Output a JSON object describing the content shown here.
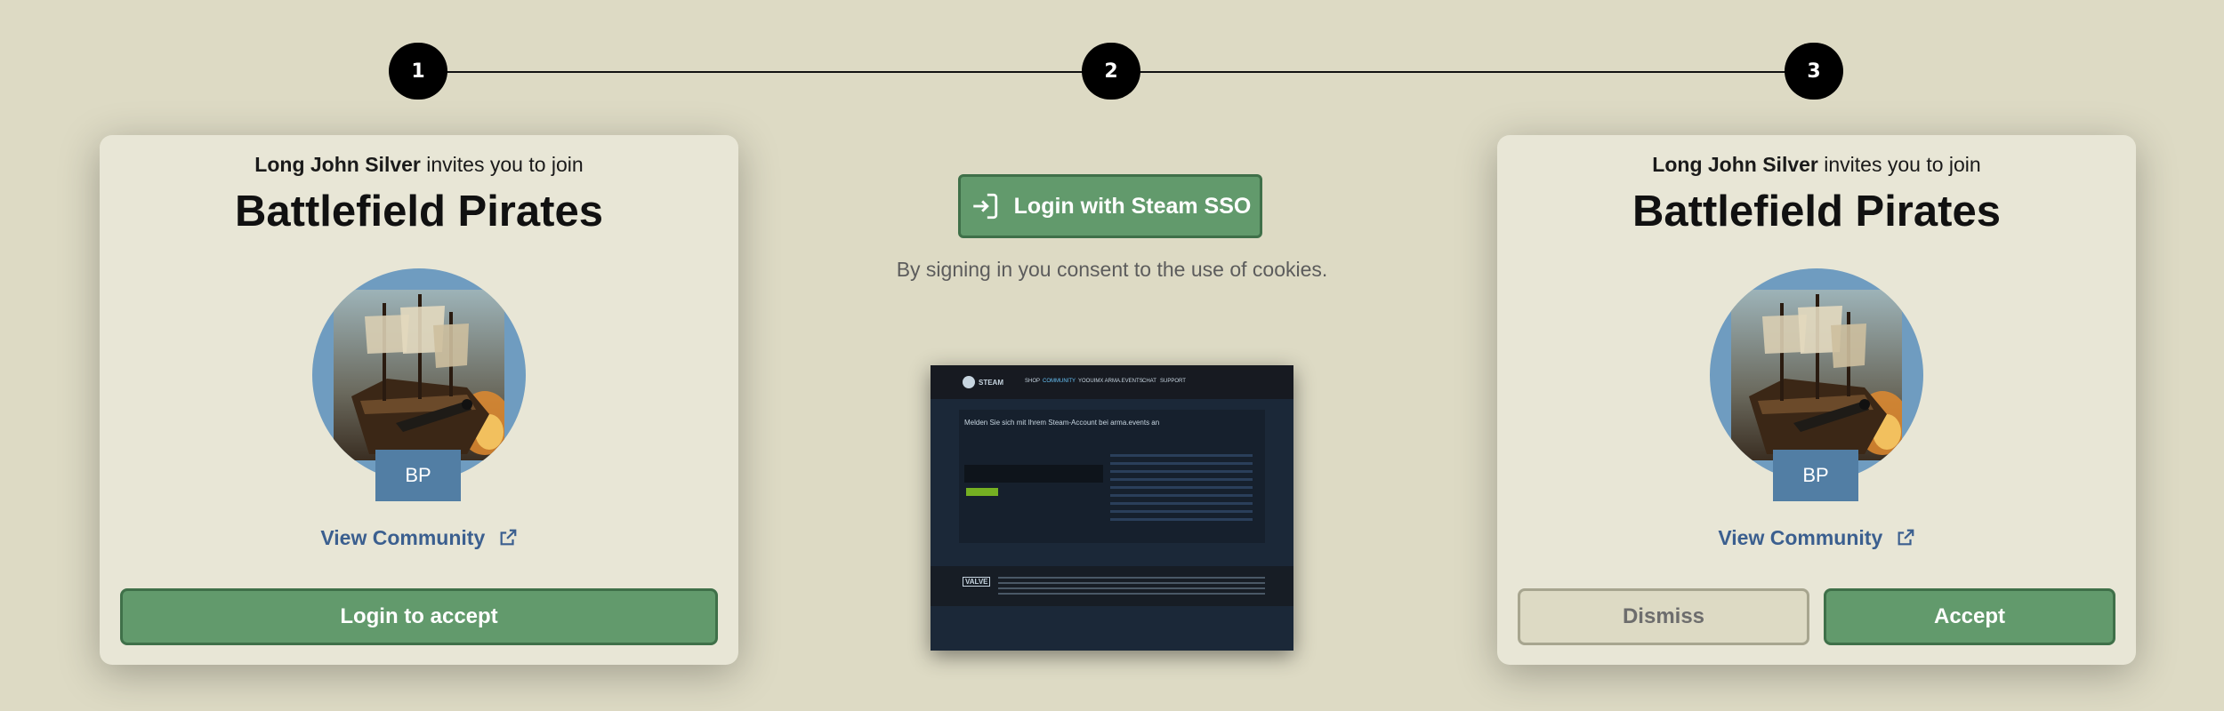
{
  "stepper": {
    "steps": [
      "1",
      "2",
      "3"
    ]
  },
  "card_left": {
    "inviter": "Long John Silver",
    "invite_suffix": "invites you to join",
    "community_name": "Battlefield Pirates",
    "abbreviation": "BP",
    "view_community": "View Community",
    "login_button": "Login to accept"
  },
  "middle": {
    "sso_button": "Login with Steam SSO",
    "consent_text": "By signing in you consent to the use of cookies.",
    "preview": {
      "brand": "STEAM",
      "nav": [
        "SHOP",
        "COMMUNITY",
        "YOOUIMX ARMA.EVENTS",
        "CHAT",
        "SUPPORT"
      ],
      "heading": "Melden Sie sich mit Ihrem Steam-Account bei arma.events an",
      "footer_brand": "VALVE"
    }
  },
  "card_right": {
    "inviter": "Long John Silver",
    "invite_suffix": "invites you to join",
    "community_name": "Battlefield Pirates",
    "abbreviation": "BP",
    "view_community": "View Community",
    "dismiss_button": "Dismiss",
    "accept_button": "Accept"
  },
  "colors": {
    "background": "#dddac4",
    "card": "#e8e6d6",
    "primary_green": "#629a6c",
    "link_blue": "#3b5f8f",
    "badge_blue": "#527ea4"
  },
  "icons": {
    "step_connector": "line",
    "external_link": "external-link-icon",
    "sign_in": "sign-in-icon"
  }
}
